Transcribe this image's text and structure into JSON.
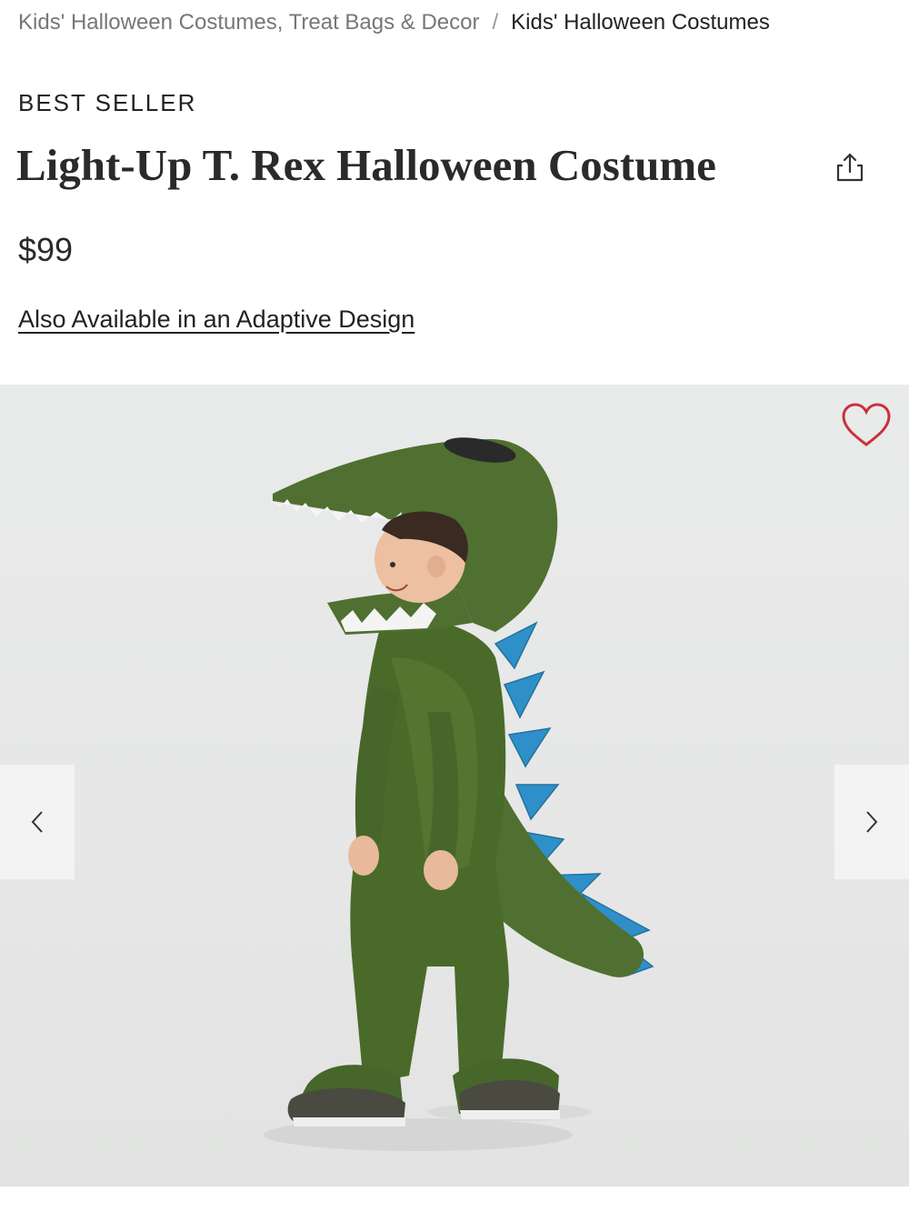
{
  "breadcrumb": {
    "parent": "Kids' Halloween Costumes, Treat Bags & Decor",
    "separator": "/",
    "current": "Kids' Halloween Costumes"
  },
  "product": {
    "badge": "BEST SELLER",
    "title": "Light-Up T. Rex Halloween Costume",
    "price": "$99",
    "adaptive_link": "Also Available in an Adaptive Design"
  },
  "gallery": {
    "prev_icon": "chevron-left-icon",
    "next_icon": "chevron-right-icon",
    "favorite_icon": "heart-icon",
    "share_icon": "share-icon",
    "accent_heart": "#c8323c",
    "costume_green": "#4a6a2a",
    "spike_blue": "#2f8fc8"
  }
}
